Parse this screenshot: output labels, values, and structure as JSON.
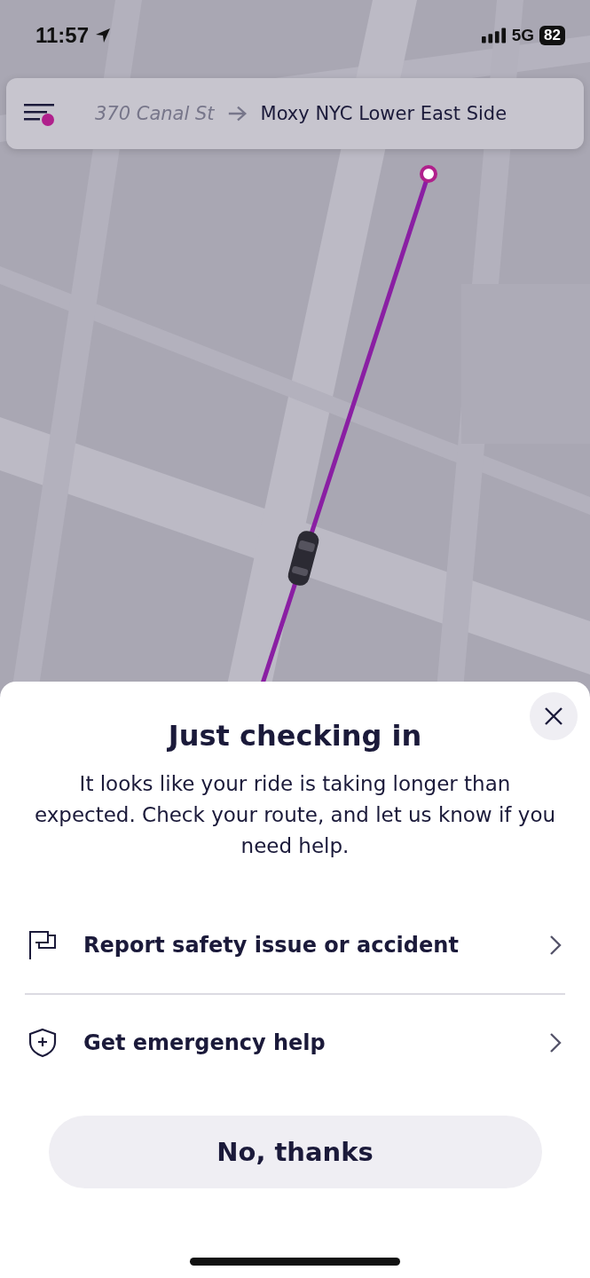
{
  "status_bar": {
    "time": "11:57",
    "network": "5G",
    "battery": "82"
  },
  "route": {
    "origin": "370 Canal St",
    "destination": "Moxy NYC Lower East Side"
  },
  "sheet": {
    "title": "Just checking in",
    "message": "It looks like your ride is taking longer than expected. Check your route, and let us know if you need help.",
    "options": [
      {
        "kind": "flag",
        "label": "Report safety issue or accident"
      },
      {
        "kind": "shield",
        "label": "Get emergency help"
      }
    ],
    "button": "No, thanks"
  }
}
